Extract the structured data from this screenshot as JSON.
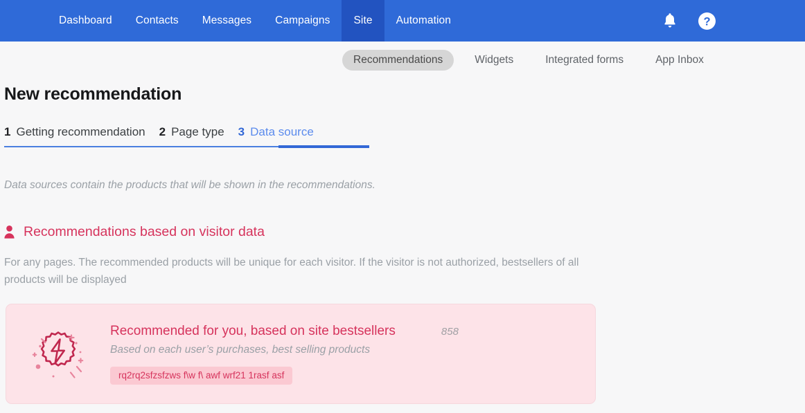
{
  "colors": {
    "header_blue": "#2f6ad8",
    "header_blue_active": "#2253c0",
    "accent_blue": "#3368d6",
    "accent_pink": "#d6335c",
    "card_bg": "#fde3e8",
    "tag_bg": "#fbc9d2",
    "page_bg": "#f7f7f8"
  },
  "topnav": {
    "items": [
      {
        "label": "Dashboard",
        "active": false
      },
      {
        "label": "Contacts",
        "active": false
      },
      {
        "label": "Messages",
        "active": false
      },
      {
        "label": "Campaigns",
        "active": false
      },
      {
        "label": "Site",
        "active": true
      },
      {
        "label": "Automation",
        "active": false
      }
    ],
    "actions": [
      {
        "icon": "bell-icon",
        "name": "notifications"
      },
      {
        "icon": "help-icon",
        "name": "help"
      }
    ]
  },
  "subnav": {
    "items": [
      {
        "label": "Recommendations",
        "active": true
      },
      {
        "label": "Widgets",
        "active": false
      },
      {
        "label": "Integrated forms",
        "active": false
      },
      {
        "label": "App Inbox",
        "active": false
      }
    ]
  },
  "page": {
    "title": "New recommendation",
    "hint": "Data sources contain the products that will be shown in the recommendations."
  },
  "steps": [
    {
      "num": "1",
      "label": "Getting recommendation",
      "active": false
    },
    {
      "num": "2",
      "label": "Page type",
      "active": false
    },
    {
      "num": "3",
      "label": "Data source",
      "active": true
    }
  ],
  "section": {
    "icon": "person-icon",
    "title": "Recommendations based on visitor data",
    "description": "For any pages. The recommended products will be unique for each visitor. If the visitor is not authorized, bestsellers of all products will be displayed"
  },
  "card": {
    "icon": "lightning-badge-icon",
    "title": "Recommended for you, based on site bestsellers",
    "count": "858",
    "subtitle": "Based on each user’s purchases, best selling products",
    "tag": "rq2rq2sfzsfzws f\\w f\\ awf wrf21 1rasf asf"
  }
}
